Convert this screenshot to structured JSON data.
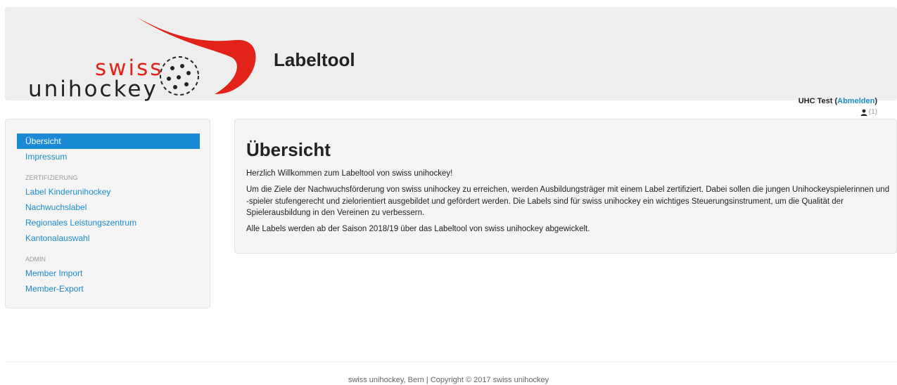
{
  "header": {
    "logo": {
      "swiss": "swiss",
      "unihockey": "unihockey"
    },
    "app_title": "Labeltool"
  },
  "user": {
    "name": "UHC Test",
    "paren_open": "(",
    "logout": "Abmelden",
    "paren_close": ")",
    "count": "(1)",
    "icon": "user-icon"
  },
  "sidebar": {
    "items": [
      {
        "label": "Übersicht",
        "active": true
      },
      {
        "label": "Impressum"
      }
    ],
    "section_zert": "ZERTIFIZIERUNG",
    "zert_items": [
      {
        "label": "Label Kinderunihockey"
      },
      {
        "label": "Nachwuchslabel"
      },
      {
        "label": "Regionales Leistungszentrum"
      },
      {
        "label": "Kantonalauswahl"
      }
    ],
    "section_admin": "ADMIN",
    "admin_items": [
      {
        "label": "Member Import"
      },
      {
        "label": "Member-Export"
      }
    ]
  },
  "main": {
    "title": "Übersicht",
    "p1": "Herzlich Willkommen zum Labeltool von swiss unihockey!",
    "p2": "Um die Ziele der Nachwuchsförderung von swiss unihockey zu erreichen, werden Ausbildungsträger mit einem Label zertifiziert. Dabei sollen  die jungen Unihockeyspielerinnen und -spieler stufengerecht und zielorientiert ausgebildet und gefördert werden. Die Labels sind für swiss unihockey ein wichtiges Steuerungsinstrument, um die Qualität der Spielerausbildung in den Vereinen zu verbessern.",
    "p3": "Alle Labels werden ab der Saison 2018/19 über das Labeltool von swiss unihockey abgewickelt."
  },
  "footer": {
    "text": "swiss unihockey, Bern  |  Copyright © 2017 swiss unihockey"
  },
  "colors": {
    "brand_red": "#e2231a",
    "link_blue": "#1a8ad4",
    "header_bg": "#eeeeee",
    "panel_bg": "#f5f5f5"
  }
}
